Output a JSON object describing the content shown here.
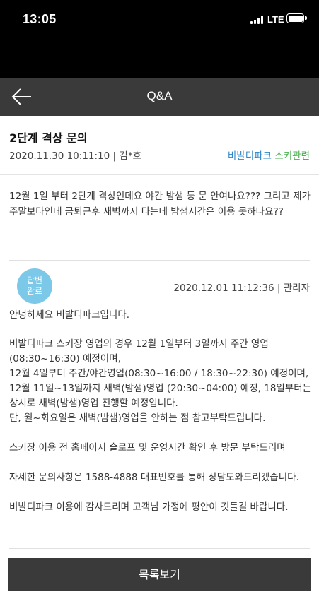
{
  "status_bar": {
    "time": "13:05",
    "network": "LTE"
  },
  "header": {
    "title": "Q&A"
  },
  "post": {
    "title": "2단계 격상 문의",
    "meta": "2020.11.30 10:11:10 | 김*호",
    "category_primary": "비발디파크",
    "category_secondary": "스키관련",
    "body": "12월 1일 부터 2단계 격상인데요 야간 밤샘 등 문 안여나요??? 그리고 제가 주말보다인데 금퇴근후 새벽까지 타는데 밤샘시간은 이용 못하나요??"
  },
  "answer": {
    "badge_line1": "답변",
    "badge_line2": "완료",
    "meta": "2020.12.01 11:12:36  |  관리자",
    "p1": "안녕하세요 비발디파크입니다.",
    "p2_l1": "비발디파크 스키장 영업의 경우 12월 1일부터 3일까지 주간 영업",
    "p2_l2": "(08:30~16:30) 예정이며,",
    "p2_l3": "12월 4일부터 주간/야간영업(08:30~16:00 / 18:30~22:30) 예정이며,",
    "p2_l4": "12월 11일~13일까지 새벽(밤샘)영업 (20:30~04:00) 예정, 18일부터는 상시로 새벽(밤샘)영업 진행할 예정입니다.",
    "p2_l5": "단, 월~화요일은 새벽(밤샘)영업을 안하는 점 참고부탁드립니다.",
    "p3": "스키장 이용 전 홈페이지 슬로프 및 운영시간 확인 후 방문 부탁드리며",
    "p4": "자세한 문의사항은 1588-4888 대표번호를 통해 상담도와드리겠습니다.",
    "p5": "비발디파크 이용에 감사드리며 고객님 가정에 평안이 깃들길 바랍니다."
  },
  "footer": {
    "list_button": "목록보기"
  },
  "colors": {
    "nav_bg": "#3a3a3a",
    "badge_bg": "#7cc8e8",
    "category_primary": "#2f86c8",
    "category_secondary": "#4caf50"
  },
  "icons": {
    "back": "arrow-left-icon",
    "signal": "signal-icon",
    "battery": "battery-icon"
  }
}
